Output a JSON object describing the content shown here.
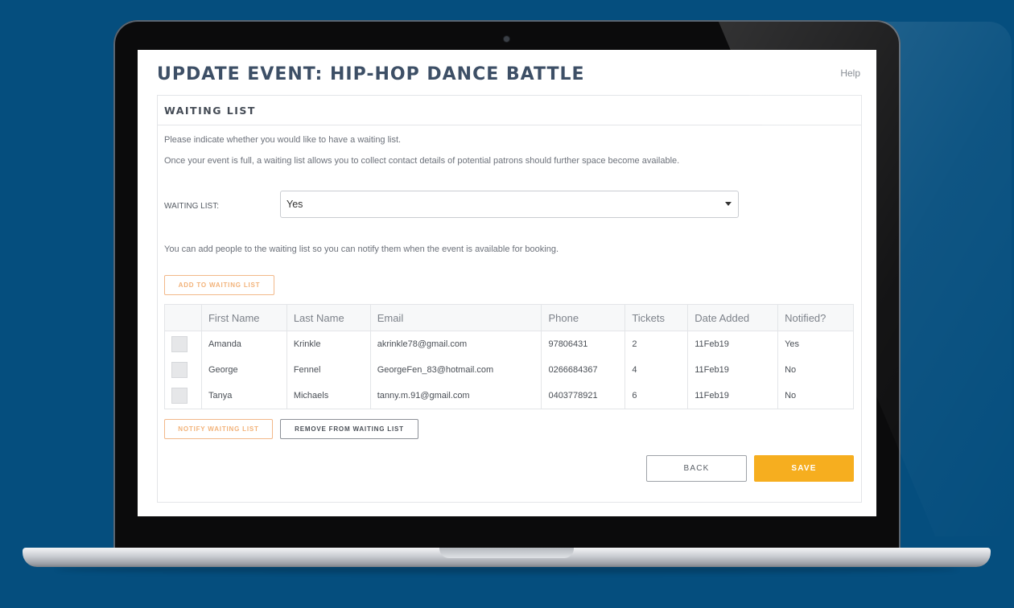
{
  "page": {
    "title": "UPDATE EVENT: HIP-HOP DANCE BATTLE",
    "help_label": "Help"
  },
  "panel": {
    "header": "WAITING LIST",
    "intro_line1": "Please indicate whether you would like to have a waiting list.",
    "intro_line2": "Once your event is full, a waiting list allows you to collect contact details of potential patrons should further space become available.",
    "field_label": "WAITING LIST:",
    "select_value": "Yes",
    "add_people_text": "You can add people to the waiting list so you can notify them when the event is available for booking."
  },
  "buttons": {
    "add_to_waiting_list": "ADD TO WAITING LIST",
    "notify_waiting_list": "NOTIFY WAITING LIST",
    "remove_from_waiting_list": "REMOVE FROM WAITING LIST",
    "back": "BACK",
    "save": "SAVE"
  },
  "table": {
    "headers": {
      "first_name": "First Name",
      "last_name": "Last Name",
      "email": "Email",
      "phone": "Phone",
      "tickets": "Tickets",
      "date_added": "Date Added",
      "notified": "Notified?"
    },
    "rows": [
      {
        "first_name": "Amanda",
        "last_name": "Krinkle",
        "email": "akrinkle78@gmail.com",
        "phone": "97806431",
        "tickets": "2",
        "date_added": "11Feb19",
        "notified": "Yes"
      },
      {
        "first_name": "George",
        "last_name": "Fennel",
        "email": "GeorgeFen_83@hotmail.com",
        "phone": "0266684367",
        "tickets": "4",
        "date_added": "11Feb19",
        "notified": "No"
      },
      {
        "first_name": "Tanya",
        "last_name": "Michaels",
        "email": "tanny.m.91@gmail.com",
        "phone": "0403778921",
        "tickets": "6",
        "date_added": "11Feb19",
        "notified": "No"
      }
    ]
  },
  "colors": {
    "background": "#054e7e",
    "accent": "#f6ae1f",
    "title": "#3d4f66",
    "orange_outline": "#f2b889"
  },
  "icons": {
    "select_caret": "caret-down-icon",
    "camera": "camera-icon"
  }
}
